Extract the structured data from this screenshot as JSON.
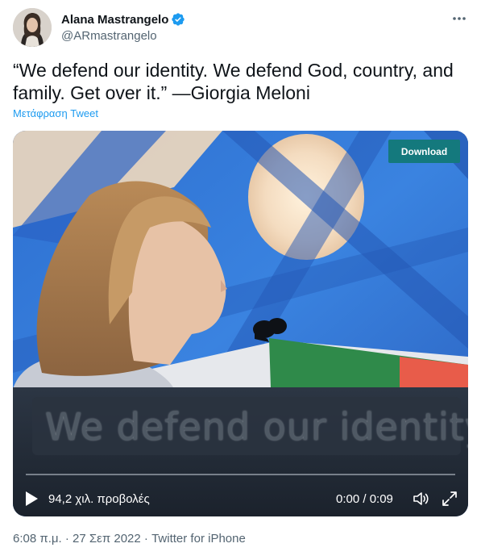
{
  "author": {
    "display_name": "Alana Mastrangelo",
    "handle": "@ARmastrangelo",
    "verified": true
  },
  "tweet": {
    "text": "“We defend our identity. We defend God, country, and family. Get over it.” —Giorgia Meloni",
    "translate_label": "Μετάφραση Tweet"
  },
  "media": {
    "download_label": "Download",
    "caption": "We defend our identity",
    "views_label": "94,2 χιλ. προβολές",
    "time_label": "0:00 / 0:09",
    "progress": 0
  },
  "meta": {
    "time": "6:08 π.μ.",
    "separator1": "·",
    "date": "27 Σεπ 2022",
    "separator2": "·",
    "source": "Twitter for iPhone"
  },
  "colors": {
    "accent": "#1d9bf0",
    "download_bg": "#14797d",
    "text_primary": "#0f1419",
    "text_secondary": "#536471"
  },
  "icons": {
    "more": "more-icon",
    "verified": "verified-badge-icon",
    "play": "play-icon",
    "volume": "volume-icon",
    "fullscreen": "fullscreen-icon"
  }
}
